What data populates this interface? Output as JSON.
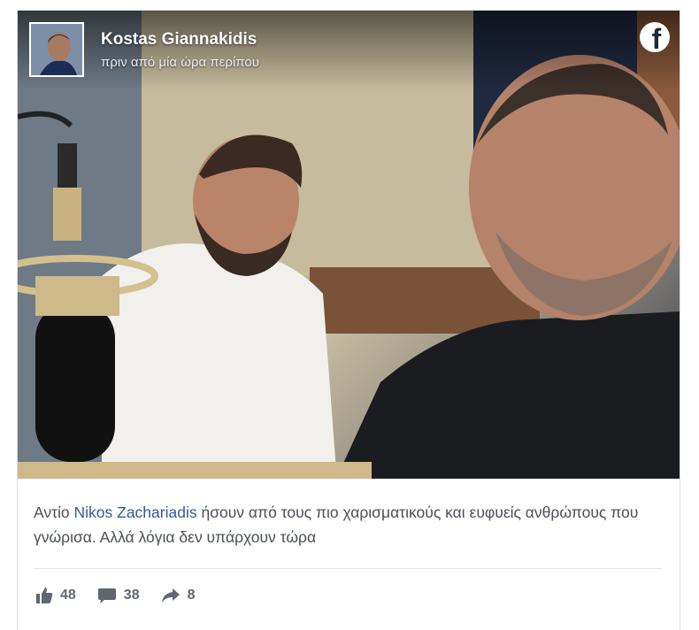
{
  "post": {
    "author": "Kostas Giannakidis",
    "timestamp": "πριν από μία ώρα περίπου",
    "caption_before": "Αντίο ",
    "mention": "Nikos Zachariadis",
    "caption_after": " ήσουν από τους πιο χαρισματικούς και ευφυείς ανθρώπους που γνώρισα. Αλλά λόγια δεν υπάρχουν τώρα",
    "platform_icon": "facebook-icon"
  },
  "stats": {
    "likes": "48",
    "comments": "38",
    "shares": "8",
    "like_icon": "thumbs-up-icon",
    "comment_icon": "comment-bubble-icon",
    "share_icon": "share-arrow-icon"
  },
  "colors": {
    "mention": "#365899",
    "text": "#4b4f56",
    "meta": "#606770"
  }
}
